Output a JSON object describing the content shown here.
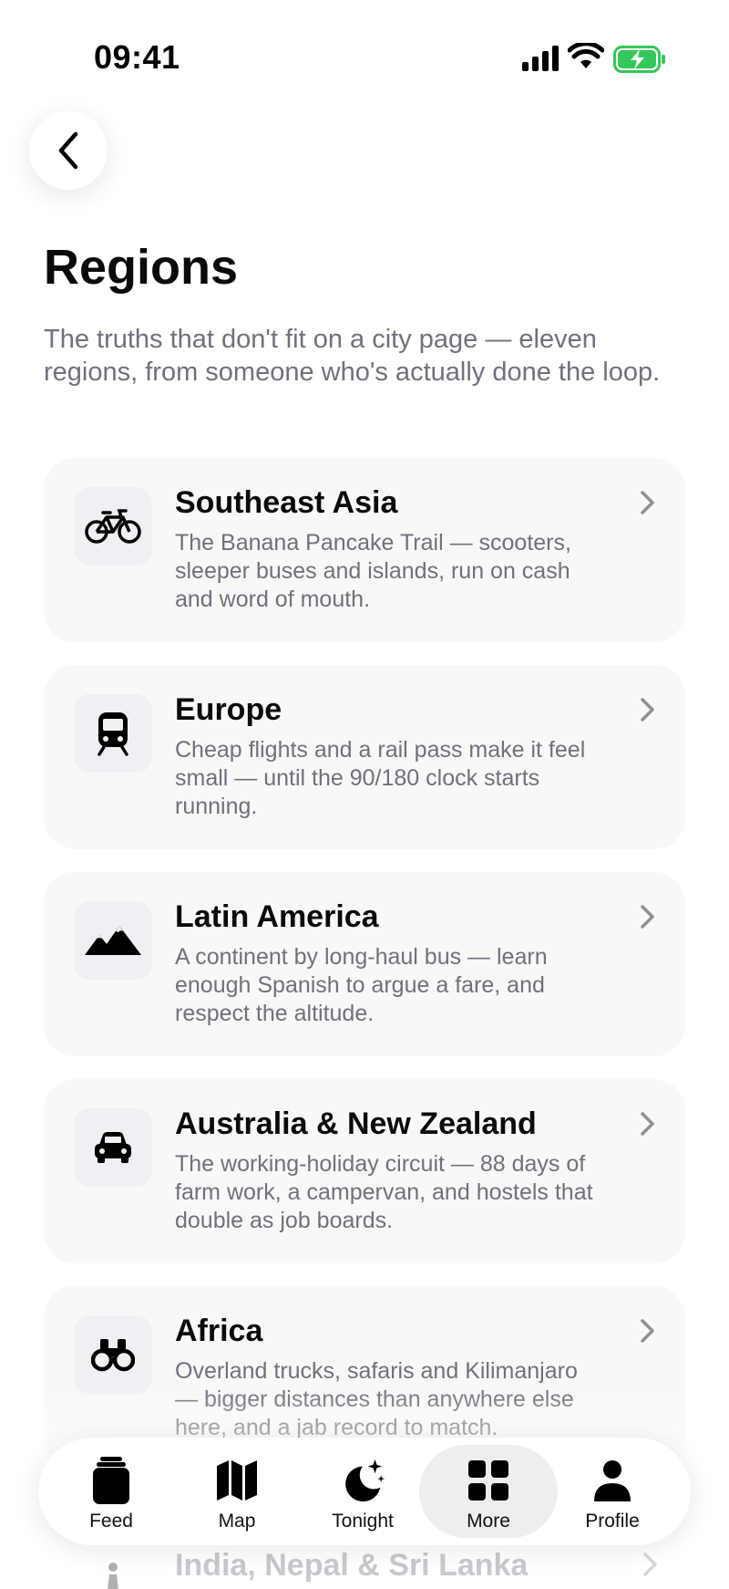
{
  "status_bar": {
    "time": "09:41"
  },
  "header": {
    "title": "Regions",
    "intro": "The truths that don't fit on a city page — eleven regions, from someone who's actually done the loop."
  },
  "regions": [
    {
      "title": "Southeast Asia",
      "description": "The Banana Pancake Trail — scooters, sleeper buses and islands, run on cash and word of mouth.",
      "icon": "bicycle-icon"
    },
    {
      "title": "Europe",
      "description": "Cheap flights and a rail pass make it feel small — until the 90/180 clock starts running.",
      "icon": "train-icon"
    },
    {
      "title": "Latin America",
      "description": "A continent by long-haul bus — learn enough Spanish to argue a fare, and respect the altitude.",
      "icon": "mountains-icon"
    },
    {
      "title": "Australia & New Zealand",
      "description": "The working-holiday circuit — 88 days of farm work, a campervan, and hostels that double as job boards.",
      "icon": "car-icon"
    },
    {
      "title": "Africa",
      "description": "Overland trucks, safaris and Kilimanjaro — bigger distances than anywhere else here, and a jab record to match.",
      "icon": "binoculars-icon"
    }
  ],
  "peek_region": {
    "title": "India, Nepal & Sri Lanka"
  },
  "tab_bar": {
    "active": "more",
    "tabs": [
      {
        "id": "feed",
        "label": "Feed",
        "icon": "feed-icon"
      },
      {
        "id": "map",
        "label": "Map",
        "icon": "map-icon"
      },
      {
        "id": "tonight",
        "label": "Tonight",
        "icon": "moon-stars-icon"
      },
      {
        "id": "more",
        "label": "More",
        "icon": "grid-icon"
      },
      {
        "id": "profile",
        "label": "Profile",
        "icon": "person-icon"
      }
    ]
  },
  "colors": {
    "text_primary": "#0a0a0a",
    "text_secondary": "#6f727a",
    "card_bg": "#f8f8f9",
    "icon_bg": "#eef0f3",
    "battery_green": "#34c759"
  }
}
